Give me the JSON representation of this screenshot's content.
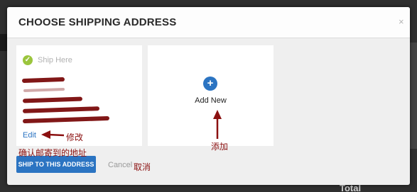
{
  "background": {
    "total_label": "Total"
  },
  "modal": {
    "title": "Choose Shipping Address",
    "close_glyph": "×"
  },
  "address_card": {
    "status_label": "Ship Here",
    "check_glyph": "✓",
    "lines": [
      "",
      "",
      "",
      "",
      ""
    ],
    "edit_label": "Edit"
  },
  "add_card": {
    "plus_glyph": "+",
    "label": "Add New"
  },
  "actions": {
    "ship_button_label": "SHIP TO THIS ADDRESS",
    "cancel_label": "Cancel"
  },
  "annotations": {
    "edit_note": "修改",
    "ship_note": "确认邮寄到的地址",
    "cancel_note": "取消",
    "add_note": "添加"
  },
  "colors": {
    "accent": "#2b74c2",
    "check_green": "#9bc53d",
    "annotation_red": "#8b1010"
  }
}
